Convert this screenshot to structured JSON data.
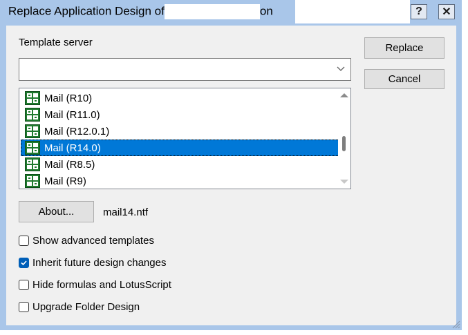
{
  "window": {
    "title": "Replace Application Design of",
    "title_suffix": "on",
    "help_label": "?",
    "close_label": "✕"
  },
  "template_server": {
    "label": "Template server",
    "value": ""
  },
  "buttons": {
    "replace": "Replace",
    "cancel": "Cancel",
    "about": "About..."
  },
  "templates": [
    {
      "label": "Mail (R10)",
      "selected": false
    },
    {
      "label": "Mail (R11.0)",
      "selected": false
    },
    {
      "label": "Mail (R12.0.1)",
      "selected": false
    },
    {
      "label": "Mail (R14.0)",
      "selected": true
    },
    {
      "label": "Mail (R8.5)",
      "selected": false
    },
    {
      "label": "Mail (R9)",
      "selected": false
    }
  ],
  "template_filename": "mail14.ntf",
  "options": [
    {
      "label": "Show advanced templates",
      "checked": false
    },
    {
      "label": "Inherit future design changes",
      "checked": true
    },
    {
      "label": "Hide formulas and LotusScript",
      "checked": false
    },
    {
      "label": "Upgrade Folder Design",
      "checked": false
    }
  ],
  "colors": {
    "frame": "#a9c6e9",
    "selection": "#0078d7",
    "checkbox_checked": "#005fb8"
  },
  "icons": {
    "template_item": "notes-database-icon",
    "combo_dropdown": "chevron-down-icon"
  }
}
